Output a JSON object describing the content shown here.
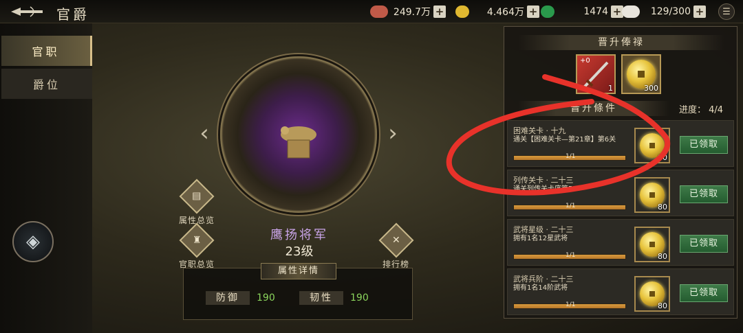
{
  "header": {
    "title": "官爵",
    "resources": [
      {
        "icon": "silver-ingot-icon",
        "value": "249.7万",
        "color": "#c05a48"
      },
      {
        "icon": "gold-coin-icon",
        "value": "4.464万",
        "color": "#e0b830"
      },
      {
        "icon": "jade-coin-icon",
        "value": "1474",
        "color": "#2a9a4c"
      },
      {
        "icon": "rice-stamina-icon",
        "value": "129/300",
        "color": "#e8e4dc"
      }
    ]
  },
  "sidebar": {
    "tabs": [
      {
        "label": "官职",
        "active": true
      },
      {
        "label": "爵位",
        "active": false
      }
    ]
  },
  "center": {
    "buttons": {
      "attr_overview": "属性总览",
      "official_overview": "官职总览",
      "leaderboard": "排行榜"
    },
    "rank_name": "鹰扬将军",
    "rank_level": "23级",
    "attr_title": "属性详情",
    "attributes": [
      {
        "key": "防御",
        "value": "190"
      },
      {
        "key": "韧性",
        "value": "190"
      }
    ]
  },
  "right": {
    "salary_title": "晋升俸禄",
    "salary_rewards": [
      {
        "icon": "sword-icon",
        "badge": "+0",
        "count": "1"
      },
      {
        "icon": "gold-coin-icon",
        "count": "300"
      }
    ],
    "conditions_title": "晋升條件",
    "progress_label": "进度：",
    "progress_value": "4/4",
    "tasks": [
      {
        "title": "困难关卡 · 十九",
        "desc": "通关【困难关卡—第21章】第6关",
        "progress": "1/1",
        "fill": 1.0,
        "reward_count": "80",
        "button": "已领取"
      },
      {
        "title": "列传关卡 · 二十三",
        "desc": "通关列传关卡序篇5-1",
        "progress": "1/1",
        "fill": 1.0,
        "reward_count": "80",
        "button": "已领取"
      },
      {
        "title": "武将星级 · 二十三",
        "desc": "拥有1名12星武将",
        "progress": "1/1",
        "fill": 1.0,
        "reward_count": "80",
        "button": "已领取"
      },
      {
        "title": "武将兵阶 · 二十三",
        "desc": "拥有1名14阶武将",
        "progress": "1/1",
        "fill": 1.0,
        "reward_count": "80",
        "button": "已领取"
      }
    ]
  },
  "colors": {
    "accent_gold": "#d8c08a",
    "rank_purple": "#c9a4e8",
    "attr_green": "#8ad45c",
    "claimed_green": "#2f6e3c",
    "annotation_red": "#e8322a"
  }
}
